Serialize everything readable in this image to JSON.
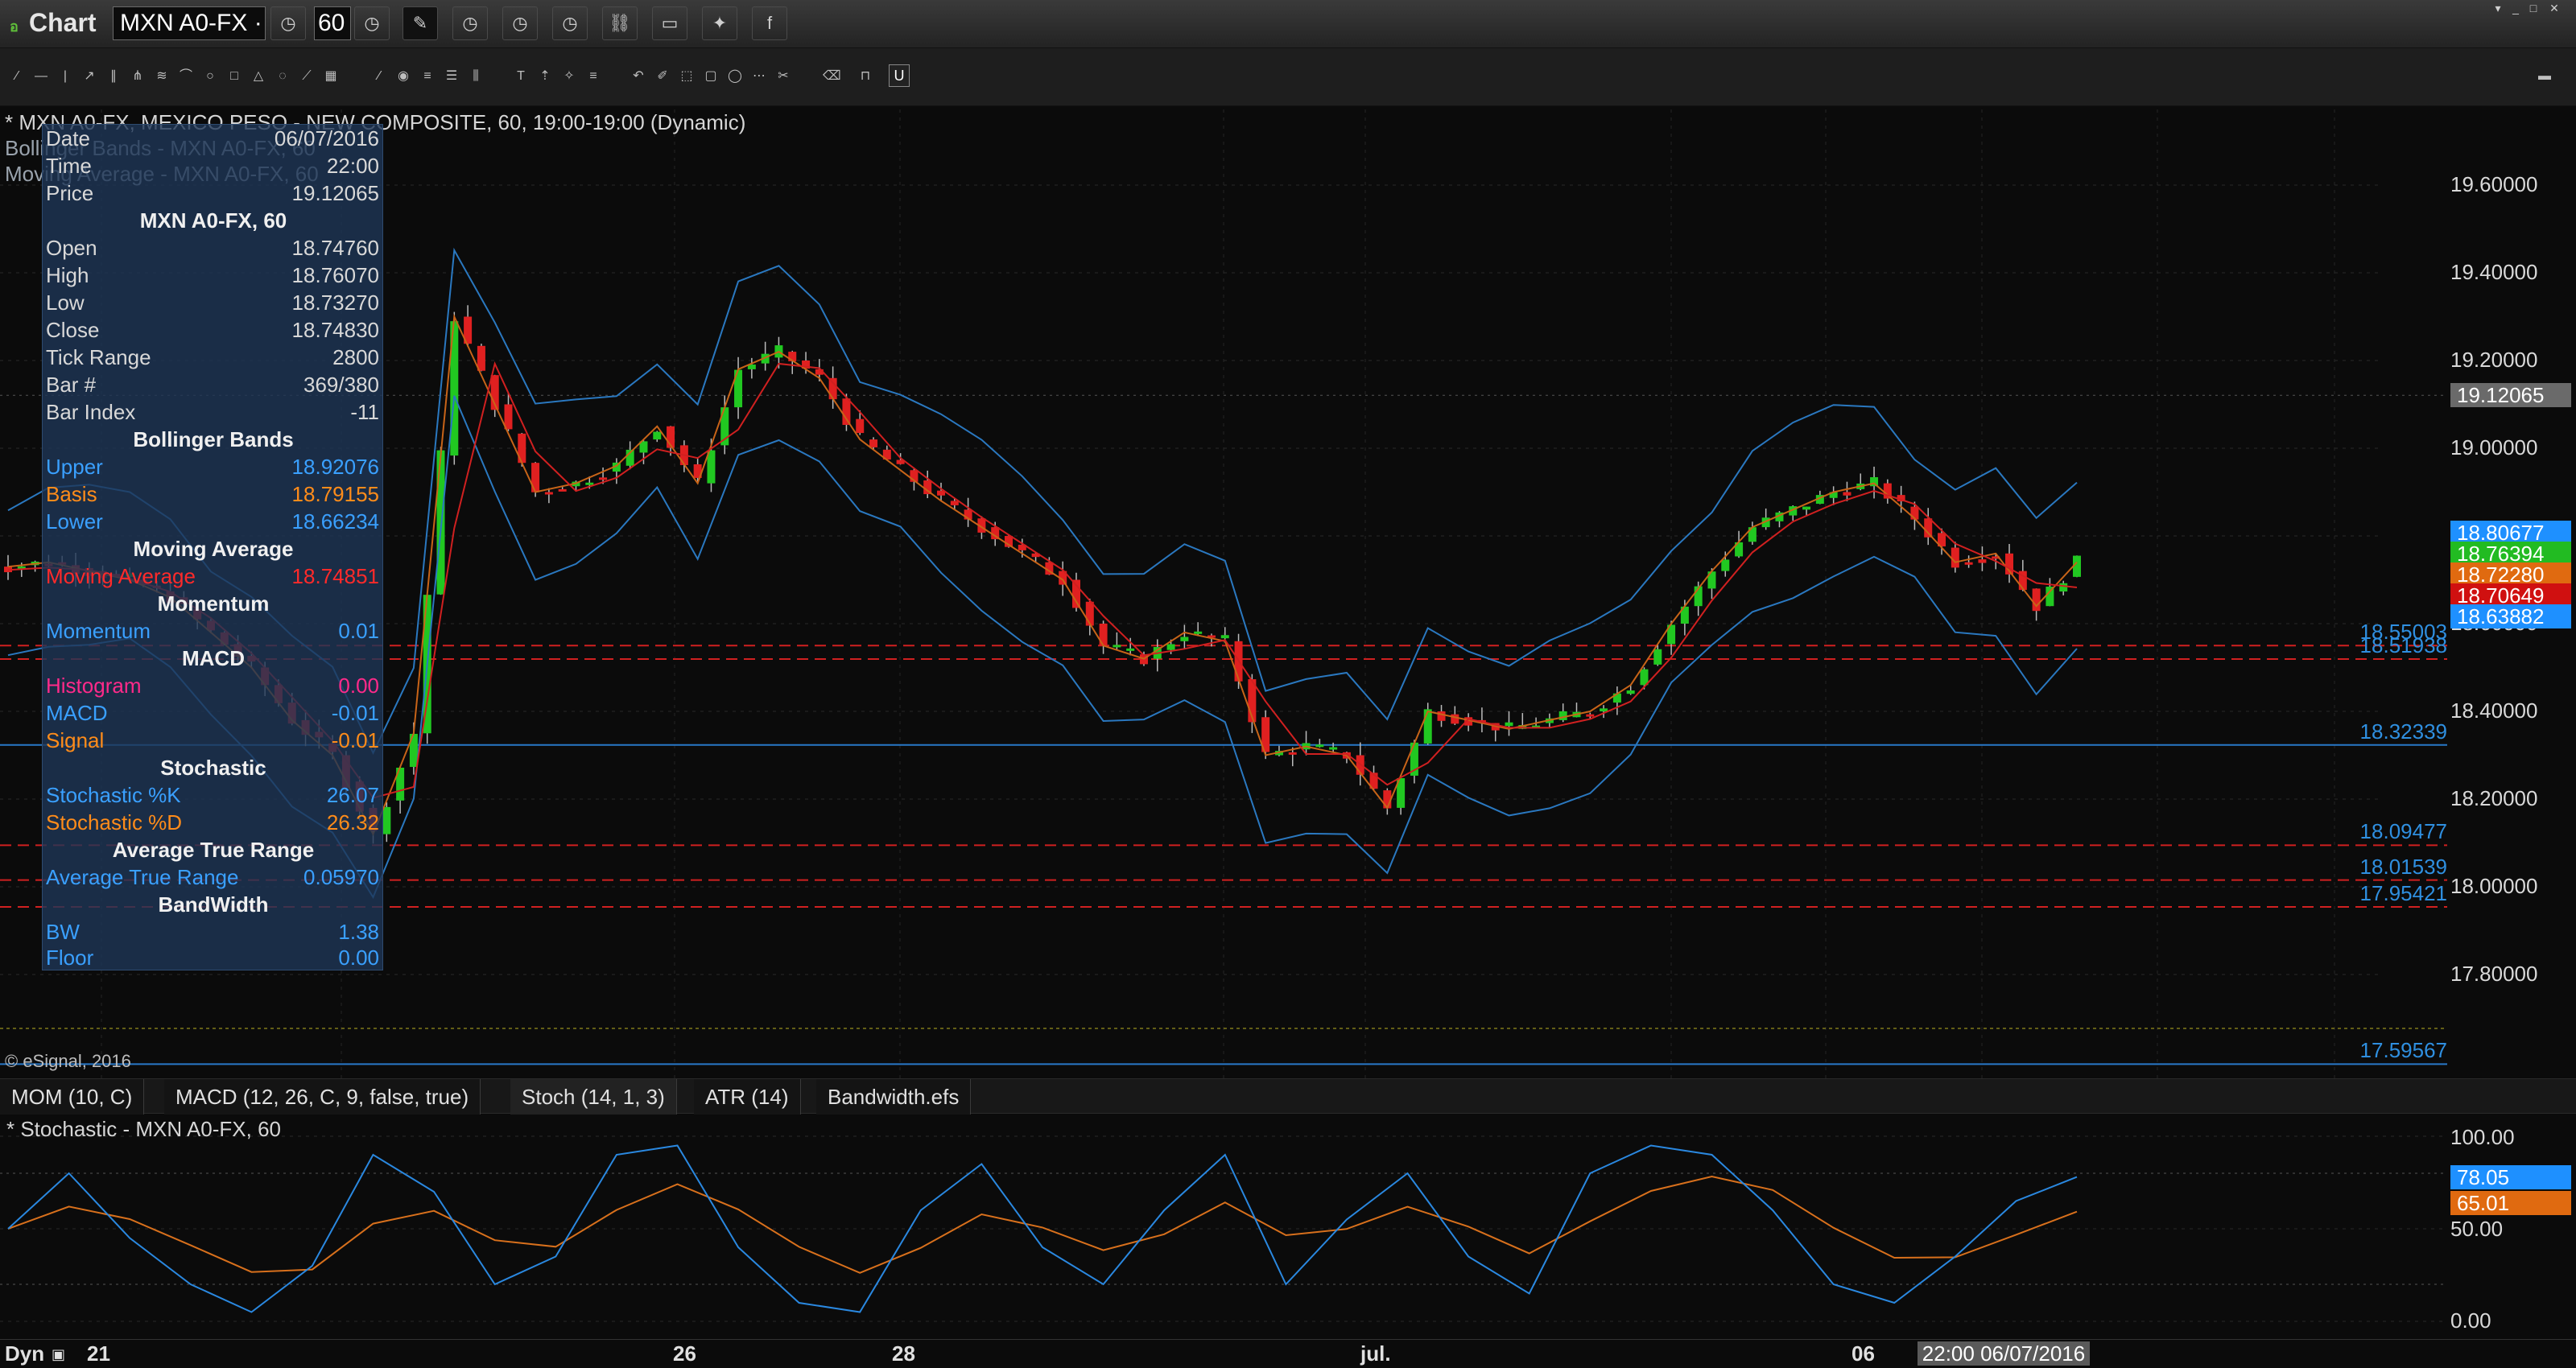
{
  "app": {
    "title": "Chart",
    "logo": "อ"
  },
  "toolbar": {
    "symbol": "MXN A0-FX ·",
    "interval": "60",
    "icons": [
      "clock-icon",
      "clock-icon",
      "pencil-icon",
      "clock-icon",
      "clock-icon",
      "clock-icon",
      "link-icon",
      "chat-icon",
      "twitter-icon",
      "facebook-icon"
    ]
  },
  "header": {
    "line1": "* MXN A0-FX, MEXICO PESO - NEW COMPOSITE, 60, 19:00-19:00 (Dynamic)",
    "line2": "Bollinger Bands - MXN A0-FX, 60",
    "line3": "Moving Average - MXN A0-FX, 60"
  },
  "info": {
    "date_label": "Date",
    "date": "06/07/2016",
    "time_label": "Time",
    "time": "22:00",
    "price_label": "Price",
    "price": "19.12065",
    "sec_symbol": "MXN A0-FX, 60",
    "open_label": "Open",
    "open": "18.74760",
    "high_label": "High",
    "high": "18.76070",
    "low_label": "Low",
    "low": "18.73270",
    "close_label": "Close",
    "close": "18.74830",
    "tickrange_label": "Tick Range",
    "tickrange": "2800",
    "bar_label": "Bar #",
    "bar": "369/380",
    "barindex_label": "Bar Index",
    "barindex": "-11",
    "sec_bb": "Bollinger Bands",
    "upper_label": "Upper",
    "upper": "18.92076",
    "basis_label": "Basis",
    "basis": "18.79155",
    "lower_label": "Lower",
    "lower": "18.66234",
    "sec_ma": "Moving Average",
    "ma_label": "Moving Average",
    "ma": "18.74851",
    "sec_mom": "Momentum",
    "mom_label": "Momentum",
    "mom": "0.01",
    "sec_macd": "MACD",
    "hist_label": "Histogram",
    "hist": "0.00",
    "macd_label": "MACD",
    "macd": "-0.01",
    "signal_label": "Signal",
    "signal": "-0.01",
    "sec_stoch": "Stochastic",
    "k_label": "Stochastic %K",
    "k": "26.07",
    "d_label": "Stochastic %D",
    "d": "26.32",
    "sec_atr": "Average True Range",
    "atr_label": "Average True Range",
    "atr": "0.05970",
    "sec_bw": "BandWidth",
    "bw_label": "BW",
    "bw": "1.38",
    "floor_label": "Floor",
    "floor": "0.00"
  },
  "copyright": "© eSignal, 2016",
  "price_axis": {
    "ticks": [
      "19.60000",
      "19.40000",
      "19.20000",
      "19.00000",
      "18.80000",
      "18.60000",
      "18.40000",
      "18.20000",
      "18.00000",
      "17.80000"
    ],
    "tick_values": [
      19.6,
      19.4,
      19.2,
      19.0,
      18.8,
      18.6,
      18.4,
      18.2,
      18.0,
      17.8
    ]
  },
  "price_tags": [
    {
      "text": "19.12065",
      "value": 19.12065,
      "color": "#6a6a6a"
    },
    {
      "text": "18.80677",
      "value": 18.80677,
      "color": "#1e90ff"
    },
    {
      "text": "18.76394",
      "value": 18.76394,
      "color": "#22bb22"
    },
    {
      "text": "18.72280",
      "value": 18.7228,
      "color": "#e06a10"
    },
    {
      "text": "18.70649",
      "value": 18.70649,
      "color": "#d01010"
    },
    {
      "text": "18.63882",
      "value": 18.63882,
      "color": "#1e90ff"
    }
  ],
  "levels": [
    {
      "text": "18.55003",
      "value": 18.55003,
      "style": "dashed",
      "color": "#d02020"
    },
    {
      "text": "18.51938",
      "value": 18.51938,
      "style": "dashed",
      "color": "#d02020"
    },
    {
      "text": "18.32339",
      "value": 18.32339,
      "style": "solid",
      "color": "#2878c8"
    },
    {
      "text": "18.09477",
      "value": 18.09477,
      "style": "dashed",
      "color": "#d02020"
    },
    {
      "text": "18.01539",
      "value": 18.01539,
      "style": "dashed",
      "color": "#d02020"
    },
    {
      "text": "17.95421",
      "value": 17.95421,
      "style": "dashed",
      "color": "#d02020"
    },
    {
      "text": "17.59567",
      "value": 17.59567,
      "style": "solid",
      "color": "#2878c8"
    }
  ],
  "tabs": [
    "MOM (10, C)",
    "MACD (12, 26, C, 9, false, true)",
    "Stoch (14, 1, 3)",
    "ATR (14)",
    "Bandwidth.efs"
  ],
  "active_tab": 2,
  "stoch": {
    "title": "* Stochastic - MXN A0-FX, 60",
    "ticks": [
      "100.00",
      "50.00",
      "0.00"
    ],
    "k_tag": "78.05",
    "d_tag": "65.01"
  },
  "time_axis": {
    "dyn": "Dyn",
    "labels": [
      "21",
      "26",
      "28",
      "jul.",
      "06"
    ],
    "crosshair": "22:00 06/07/2016"
  },
  "chart_data": {
    "type": "candlestick",
    "title": "* MXN A0-FX, MEXICO PESO - NEW COMPOSITE, 60, 19:00-19:00 (Dynamic)",
    "x": [
      "21",
      "26",
      "28",
      "jul.",
      "06"
    ],
    "ylim": [
      17.5,
      19.75
    ],
    "series": [
      {
        "name": "Close",
        "values": [
          18.73,
          18.74,
          18.72,
          18.7,
          18.66,
          18.58,
          18.5,
          18.38,
          18.3,
          18.12,
          18.35,
          19.3,
          19.1,
          18.9,
          18.92,
          18.96,
          19.05,
          18.92,
          19.18,
          19.22,
          19.16,
          19.02,
          18.95,
          18.88,
          18.82,
          18.76,
          18.7,
          18.55,
          18.52,
          18.58,
          18.56,
          18.3,
          18.32,
          18.3,
          18.18,
          18.4,
          18.38,
          18.36,
          18.38,
          18.4,
          18.46,
          18.6,
          18.72,
          18.82,
          18.86,
          18.9,
          18.92,
          18.84,
          18.74,
          18.76,
          18.64,
          18.74
        ]
      }
    ],
    "bollinger": {
      "upper": 18.92076,
      "basis": 18.79155,
      "lower": 18.66234
    },
    "moving_average": 18.74851,
    "stochastic": {
      "k": [
        50,
        80,
        45,
        20,
        5,
        30,
        90,
        70,
        20,
        35,
        90,
        95,
        40,
        10,
        5,
        60,
        85,
        40,
        20,
        60,
        90,
        20,
        55,
        80,
        35,
        15,
        80,
        95,
        90,
        60,
        20,
        10,
        35,
        65,
        78
      ],
      "ylim": [
        0,
        100
      ]
    }
  }
}
